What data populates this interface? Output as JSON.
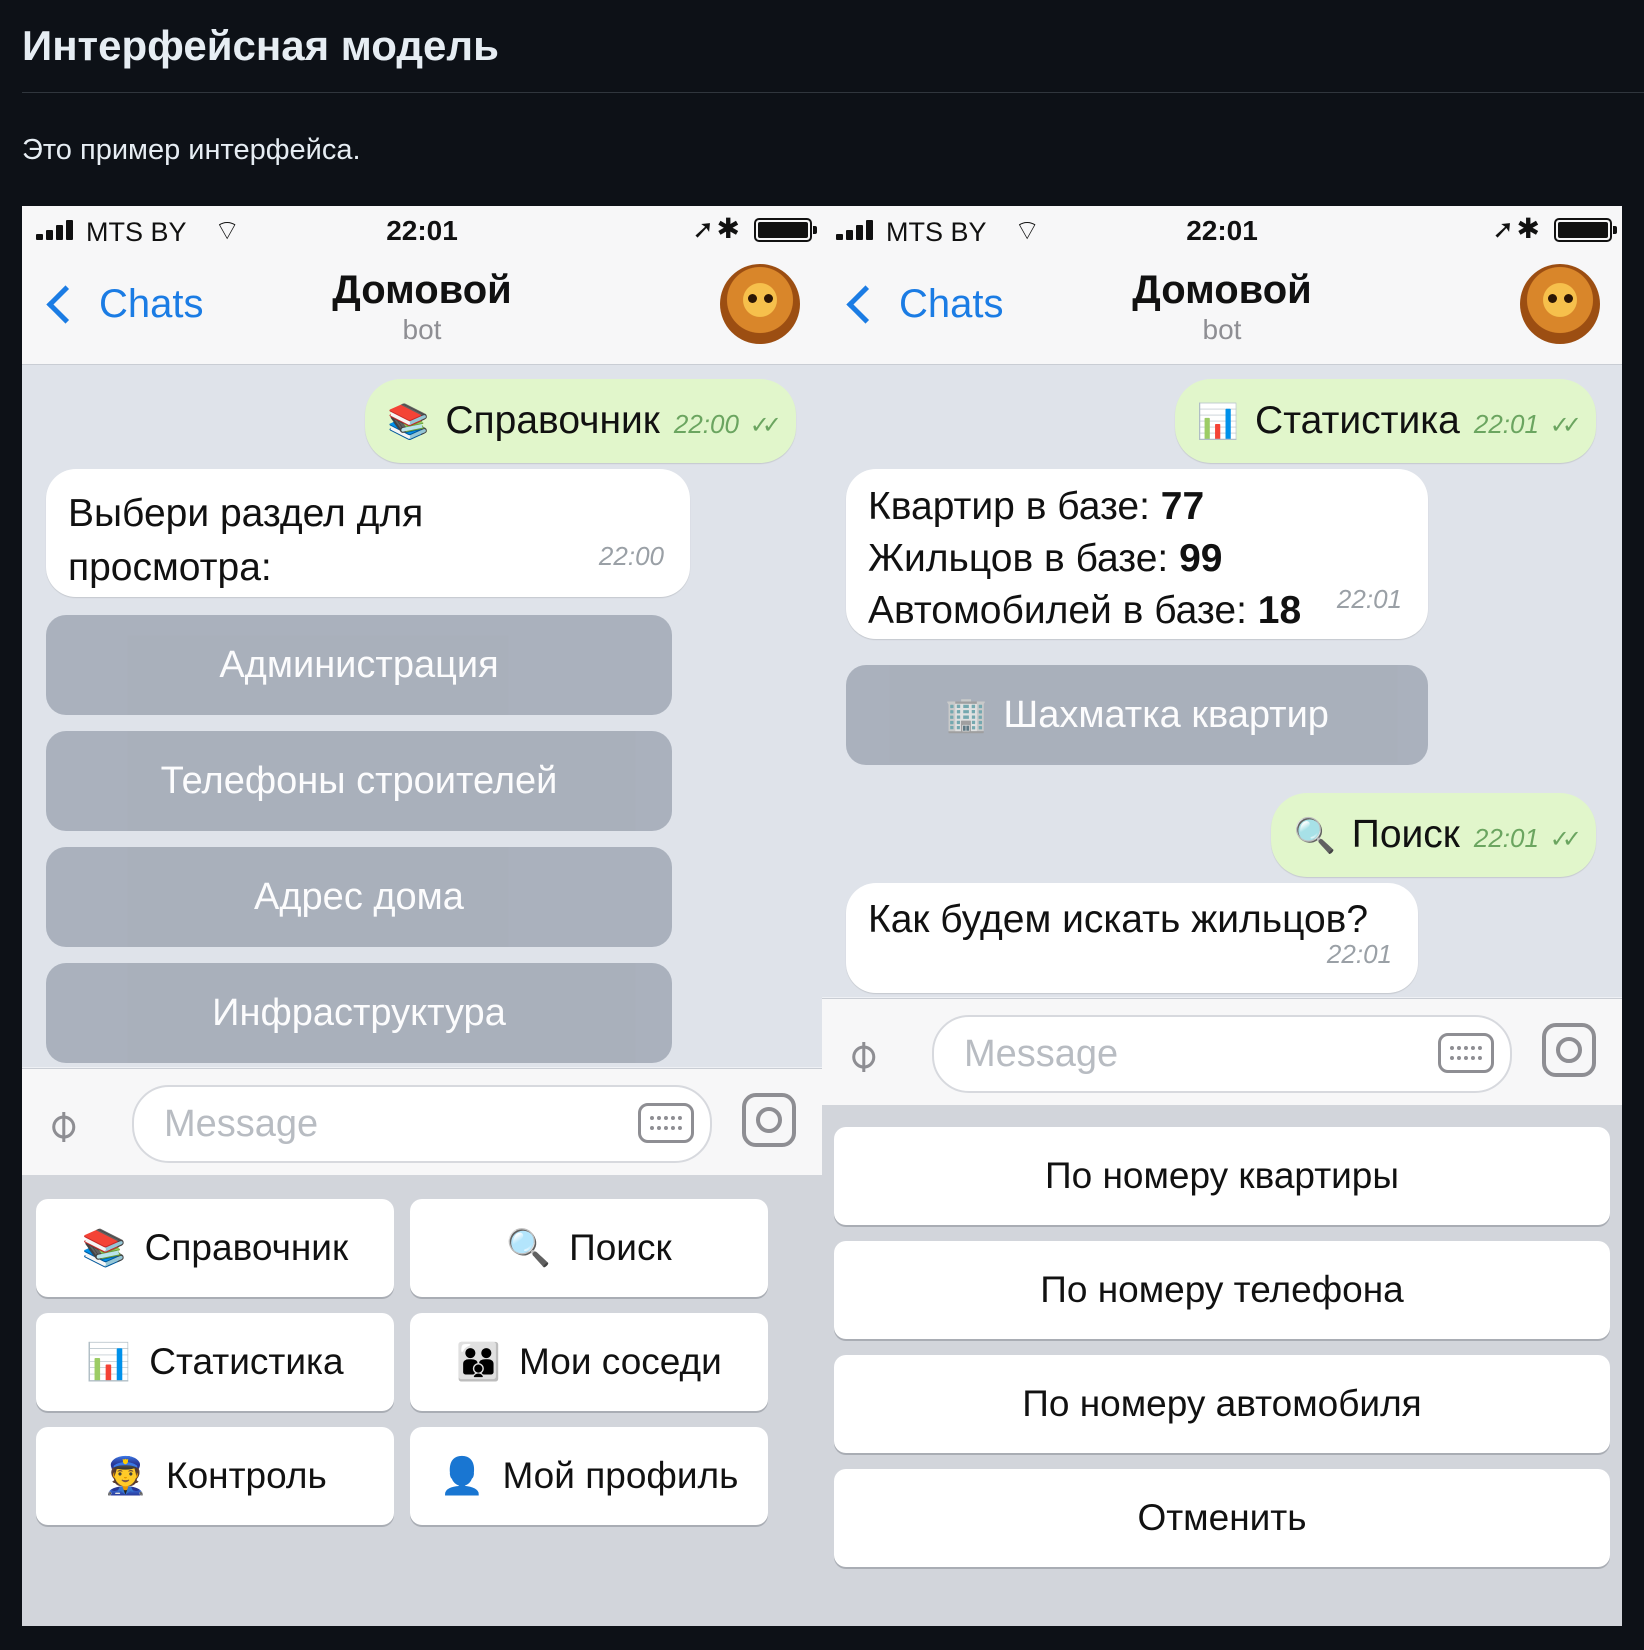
{
  "page": {
    "title": "Интерфейсная модель",
    "intro": "Это пример интерфейса."
  },
  "left": {
    "status": {
      "carrier": "MTS BY",
      "time": "22:01"
    },
    "nav": {
      "back_label": "Chats",
      "title": "Домовой",
      "subtitle": "bot"
    },
    "messages": [
      {
        "emoji": "📚",
        "text": "Справочник",
        "time": "22:00",
        "ticks": "✓✓"
      },
      {
        "text_line1": "Выбери раздел для",
        "text_line2": "просмотра:",
        "time": "22:00"
      }
    ],
    "inline_buttons": [
      "Администрация",
      "Телефоны строителей",
      "Адрес дома",
      "Инфраструктура"
    ],
    "input": {
      "placeholder": "Message"
    },
    "keyboard": [
      {
        "emoji": "📚",
        "label": "Справочник"
      },
      {
        "emoji": "🔍",
        "label": "Поиск"
      },
      {
        "emoji": "📊",
        "label": "Статистика"
      },
      {
        "emoji": "👪",
        "label": "Мои соседи"
      },
      {
        "emoji": "👮",
        "label": "Контроль"
      },
      {
        "emoji": "👤",
        "label": "Мой профиль"
      }
    ]
  },
  "right": {
    "status": {
      "carrier": "MTS BY",
      "time": "22:01"
    },
    "nav": {
      "back_label": "Chats",
      "title": "Домовой",
      "subtitle": "bot"
    },
    "messages": [
      {
        "emoji": "📊",
        "text": "Статистика",
        "time": "22:01",
        "ticks": "✓✓"
      },
      {
        "line1_label": "Квартир в базе:",
        "line1_value": "77",
        "line2_label": "Жильцов в базе:",
        "line2_value": "99",
        "line3_label": "Автомобилей в базе:",
        "line3_value": "18",
        "time": "22:01"
      },
      {
        "emoji": "🔍",
        "text": "Поиск",
        "time": "22:01",
        "ticks": "✓✓"
      },
      {
        "text": "Как будем искать жильцов?",
        "time": "22:01"
      }
    ],
    "inline_buttons": [
      {
        "emoji": "🏢",
        "label": "Шахматка квартир"
      }
    ],
    "input": {
      "placeholder": "Message"
    },
    "keyboard": [
      "По номеру квартиры",
      "По номеру телефона",
      "По номеру автомобиля",
      "Отменить"
    ]
  },
  "icons": {
    "signal": "signal-bars-icon",
    "wifi": "wifi-icon",
    "location": "location-arrow-icon",
    "bluetooth": "bluetooth-icon",
    "battery": "battery-icon",
    "back": "chevron-left-icon",
    "attach": "paperclip-icon",
    "keyboard": "keyboard-icon",
    "camera": "camera-icon"
  },
  "colors": {
    "accent": "#1b7ce4",
    "outgoing_bubble": "#e1f6cb",
    "incoming_bubble": "#ffffff",
    "inline_button": "#a5acb8",
    "page_background": "#0d1117"
  }
}
